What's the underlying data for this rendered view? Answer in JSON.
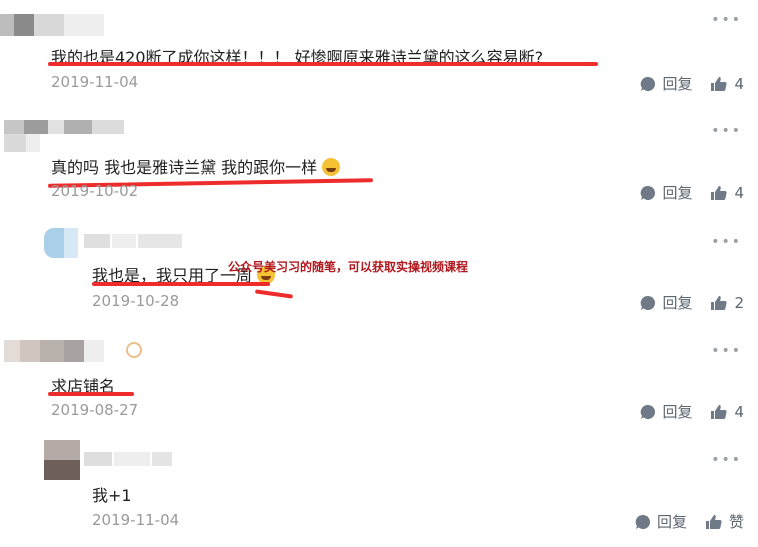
{
  "comments": [
    {
      "text": "我的也是420断了成你这样！！！ 好惨啊原来雅诗兰黛的这么容易断?",
      "date": "2019-11-04",
      "reply": "回复",
      "likes": "4"
    },
    {
      "text": "真的吗 我也是雅诗兰黛 我的跟你一样",
      "date": "2019-10-02",
      "reply": "回复",
      "likes": "4"
    },
    {
      "text": "我也是，我只用了一周",
      "date": "2019-10-28",
      "reply": "回复",
      "likes": "2"
    },
    {
      "text": "求店铺名",
      "date": "2019-08-27",
      "reply": "回复",
      "likes": "4"
    },
    {
      "text": "我+1",
      "date": "2019-11-04",
      "reply": "回复",
      "likes": "赞"
    }
  ],
  "overlay_text": "公众号美习习的随笔，可以获取实操视频课程",
  "more_icon": "more-dots-icon",
  "colors": {
    "underline": "#ef2c2c",
    "overlay": "#b1191e",
    "icon": "#5b6670"
  }
}
